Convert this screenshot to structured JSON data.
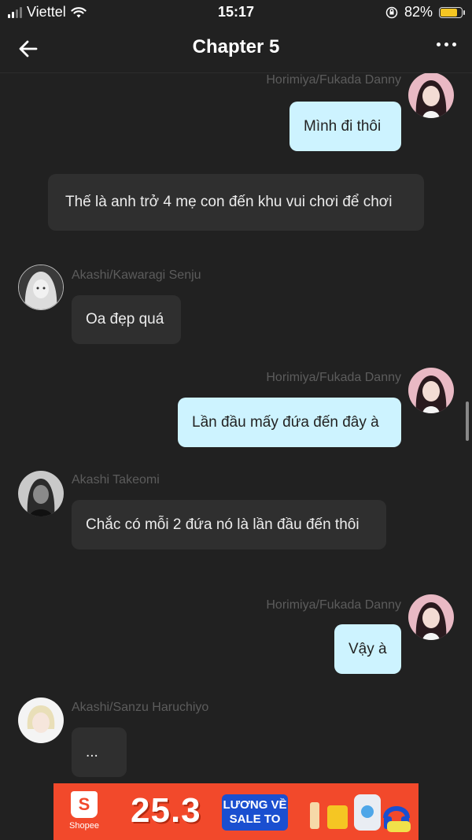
{
  "status_bar": {
    "carrier": "Viettel",
    "time": "15:17",
    "battery_percent": "82%",
    "battery_level": 0.82,
    "battery_color": "#f5c623"
  },
  "header": {
    "back_icon": "arrow-left-icon",
    "title": "Chapter 5",
    "more_icon": "more-horizontal-icon"
  },
  "messages": [
    {
      "side": "mine",
      "sender": "Horimiya/Fukada Danny",
      "text": "Mình đi thôi"
    },
    {
      "side": "narration",
      "sender": "",
      "text": "Thế là anh trở 4 mẹ con đến khu vui chơi để chơi"
    },
    {
      "side": "theirs",
      "sender": "Akashi/Kawaragi Senju",
      "text": "Oa đẹp quá"
    },
    {
      "side": "mine",
      "sender": "Horimiya/Fukada Danny",
      "text": "Lần đầu mấy đứa đến đây à"
    },
    {
      "side": "theirs",
      "sender": "Akashi Takeomi",
      "text": "Chắc có mỗi 2 đứa nó là lần đầu đến thôi"
    },
    {
      "side": "mine",
      "sender": "Horimiya/Fukada Danny",
      "text": "Vậy à"
    },
    {
      "side": "theirs",
      "sender": "Akashi/Sanzu Haruchiyo",
      "text": "..."
    }
  ],
  "ad": {
    "brand": "Shopee",
    "logo_letter": "S",
    "headline": "25.3",
    "tag_line1": "LƯƠNG VỀ",
    "tag_line2": "SALE TO",
    "brand_color": "#f2492b"
  }
}
